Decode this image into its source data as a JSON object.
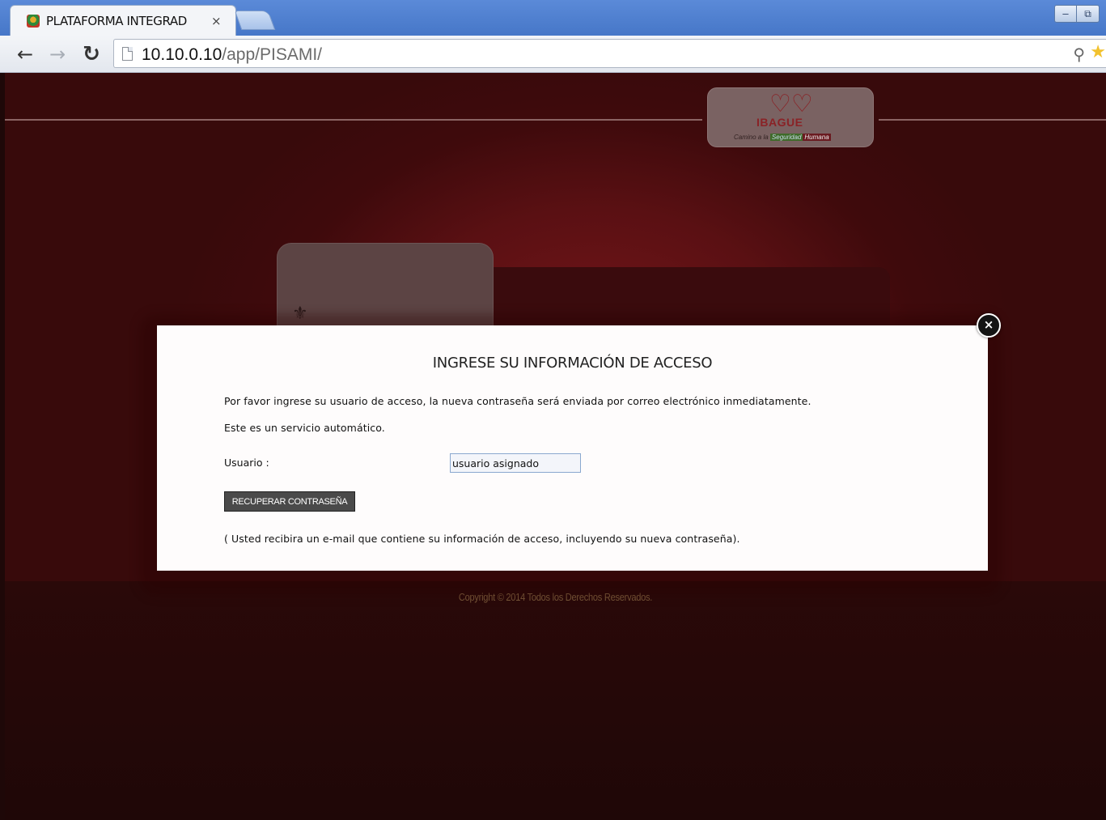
{
  "browser": {
    "tab_title": "PLATAFORMA INTEGRAD",
    "tab_close": "×",
    "url_host": "10.10.0.10",
    "url_path": "/app/PISAMI/",
    "win_minimize": "–",
    "win_restore": "⧉"
  },
  "header": {
    "logo_word": "IBAGUE",
    "logo_tag_start": "Camino a la",
    "logo_tag_highlight": "Seguridad",
    "logo_tag_end": "Humana"
  },
  "modal": {
    "title": "INGRESE SU INFORMACIÓN DE ACCESO",
    "intro": "Por favor ingrese su usuario de acceso, la nueva contraseña será enviada por correo electrónico inmediatamente.",
    "automatic_note": "Este es un servicio automático.",
    "user_label": "Usuario :",
    "user_value": "usuario asignado",
    "recover_button": "RECUPERAR CONTRASEÑA",
    "footer_note": "( Usted recibira un e-mail que contiene su información de acceso, incluyendo su nueva contraseña).",
    "close_symbol": "×"
  },
  "footer": {
    "copyright": "Copyright © 2014   Todos los Derechos Reservados."
  },
  "colors": {
    "chrome_blue": "#4677c8",
    "page_red": "#5a1013",
    "page_dark": "#230808",
    "button_gray": "#4a4a4a"
  }
}
